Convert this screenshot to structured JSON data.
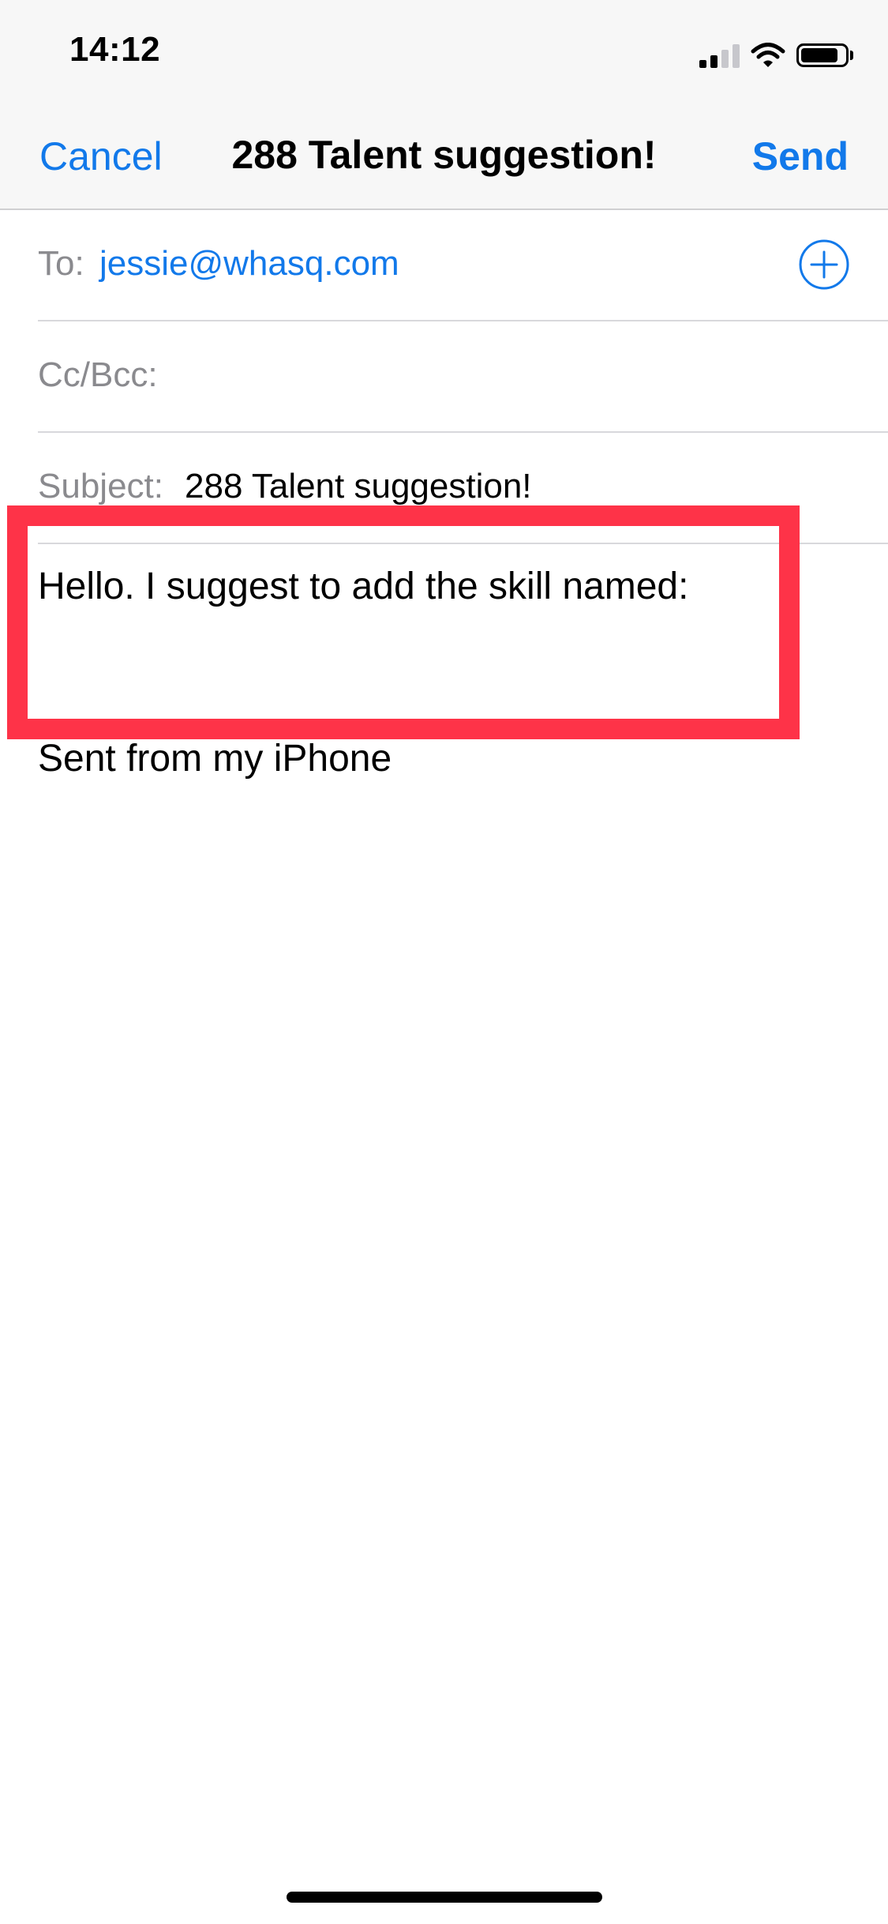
{
  "status_bar": {
    "time": "14:12",
    "signal_icon": "cellular-signal-icon",
    "wifi_icon": "wifi-icon",
    "battery_icon": "battery-icon"
  },
  "nav": {
    "cancel_label": "Cancel",
    "title": "288 Talent suggestion!",
    "send_label": "Send"
  },
  "fields": {
    "to_label": "To:",
    "to_value": "jessie@whasq.com",
    "add_contact_icon": "plus-circle-icon",
    "cc_bcc_label": "Cc/Bcc:",
    "subject_label": "Subject:",
    "subject_value": "288 Talent suggestion!"
  },
  "body": {
    "text": "Hello. I suggest to add the skill named:",
    "signature": "Sent from my iPhone"
  },
  "colors": {
    "accent": "#1279ea",
    "highlight": "#fe3348",
    "label_gray": "#8a8a8e"
  }
}
